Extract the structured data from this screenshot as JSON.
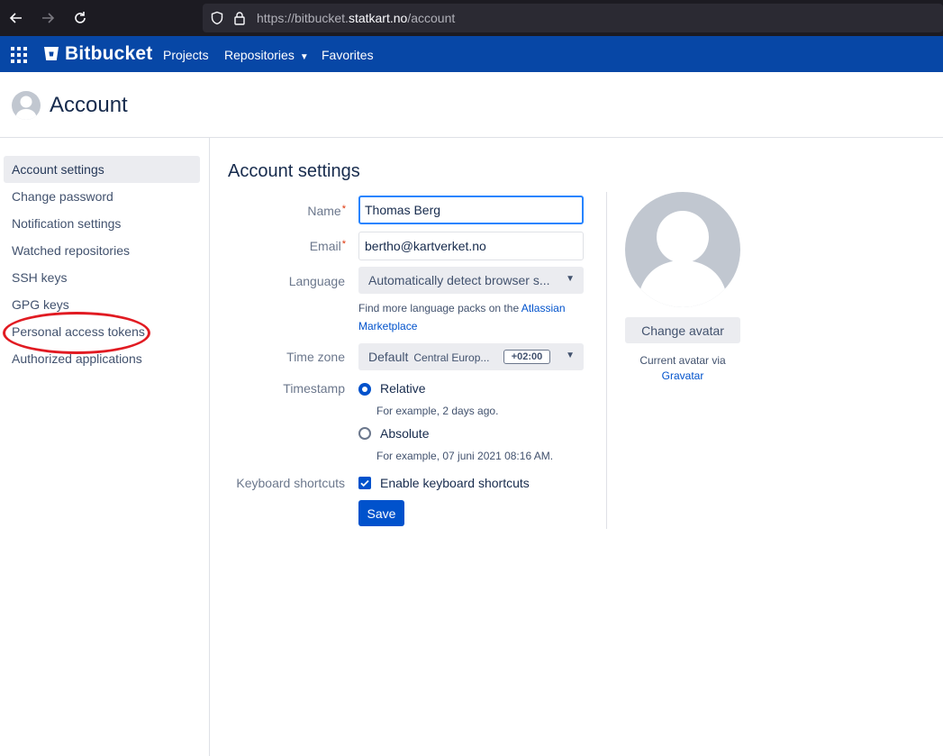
{
  "browser": {
    "url_prefix": "https://bitbucket.",
    "url_host": "statkart.no",
    "url_path": "/account"
  },
  "app_header": {
    "logo_text": "Bitbucket",
    "nav": {
      "projects": "Projects",
      "repositories": "Repositories",
      "favorites": "Favorites"
    }
  },
  "page": {
    "title": "Account"
  },
  "sidebar": {
    "items": [
      {
        "label": "Account settings",
        "active": true
      },
      {
        "label": "Change password"
      },
      {
        "label": "Notification settings"
      },
      {
        "label": "Watched repositories"
      },
      {
        "label": "SSH keys"
      },
      {
        "label": "GPG keys"
      },
      {
        "label": "Personal access tokens",
        "highlighted": true
      },
      {
        "label": "Authorized applications"
      }
    ]
  },
  "form": {
    "title": "Account settings",
    "name": {
      "label": "Name",
      "value": "Thomas Berg"
    },
    "email": {
      "label": "Email",
      "value": "bertho@kartverket.no"
    },
    "required_mark": "*",
    "language": {
      "label": "Language",
      "selected": "Automatically detect browser s...",
      "help_prefix": "Find more language packs on the ",
      "help_link_1": "Atlassian",
      "help_link_2": "Marketplace"
    },
    "timezone": {
      "label": "Time zone",
      "selected": "Default",
      "region": "Central Europ...",
      "offset": "+02:00"
    },
    "timestamp": {
      "label": "Timestamp",
      "relative_label": "Relative",
      "relative_example": "For example, 2 days ago.",
      "absolute_label": "Absolute",
      "absolute_example": "For example, 07 juni 2021 08:16 AM.",
      "selected": "relative"
    },
    "keyboard": {
      "label": "Keyboard shortcuts",
      "checkbox_label": "Enable keyboard shortcuts",
      "checked": true
    },
    "save_label": "Save"
  },
  "avatar": {
    "change_label": "Change avatar",
    "note": "Current avatar via",
    "link": "Gravatar"
  },
  "colors": {
    "header_blue": "#0747a6",
    "primary": "#0052cc",
    "annotation_red": "#e11b22"
  }
}
